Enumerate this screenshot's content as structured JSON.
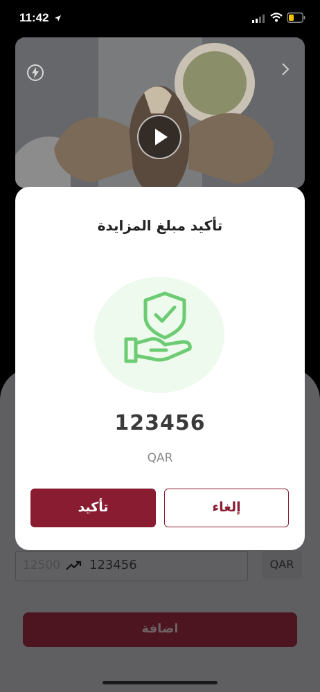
{
  "status_bar": {
    "time": "11:42"
  },
  "dialog": {
    "title": "تأكيد مبلغ المزايدة",
    "amount": "123456",
    "currency": "QAR",
    "confirm_label": "تأكيد",
    "cancel_label": "إلغاء"
  },
  "form": {
    "min_bid": "12500",
    "bid_value": "123456",
    "currency": "QAR",
    "add_label": "اضافة"
  },
  "colors": {
    "brand": "#8a1c32",
    "icon_green": "#6dcc73",
    "icon_bg": "#eefaee"
  },
  "icons": [
    "location-arrow-icon",
    "signal-icon",
    "wifi-icon",
    "battery-icon",
    "flash-icon",
    "chevron-right-icon",
    "play-icon",
    "trend-up-icon",
    "shield-hand-icon"
  ]
}
